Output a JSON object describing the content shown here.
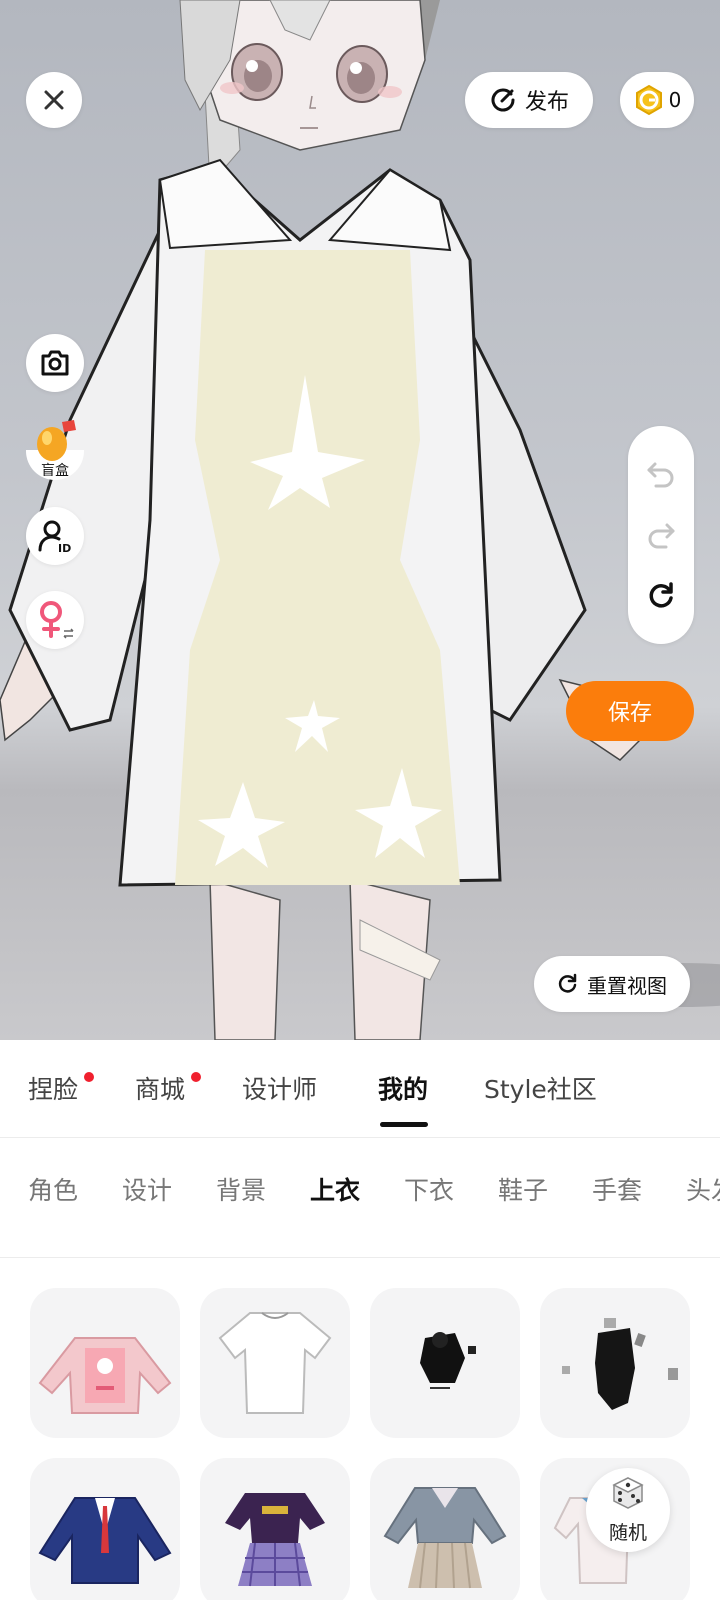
{
  "top_bar": {
    "close_icon": "close-icon",
    "publish_label": "发布",
    "publish_icon": "publish-icon",
    "coin_icon": "coin-icon",
    "coin_count": "0"
  },
  "side_tools": {
    "camera_icon": "camera-icon",
    "blind_box_label": "盲盒",
    "blind_box_icon": "egg-icon",
    "avatar_id_icon": "avatar-id-icon",
    "gender_icon": "female-gender-icon"
  },
  "history": {
    "undo_icon": "undo-icon",
    "redo_icon": "redo-icon",
    "refresh_icon": "refresh-icon"
  },
  "save_label": "保存",
  "reset_view_label": "重置视图",
  "main_tabs": [
    {
      "label": "捏脸",
      "badge": true
    },
    {
      "label": "商城",
      "badge": true
    },
    {
      "label": "设计师",
      "badge": false
    },
    {
      "label": "我的",
      "badge": false,
      "active": true
    },
    {
      "label": "Style社区",
      "badge": false
    }
  ],
  "sub_tabs": [
    {
      "label": "角色"
    },
    {
      "label": "设计"
    },
    {
      "label": "背景"
    },
    {
      "label": "上衣",
      "active": true
    },
    {
      "label": "下衣"
    },
    {
      "label": "鞋子"
    },
    {
      "label": "手套"
    },
    {
      "label": "头发"
    }
  ],
  "items": [
    {
      "name": "pink-bunny-sweater"
    },
    {
      "name": "white-tshirt"
    },
    {
      "name": "black-top"
    },
    {
      "name": "black-bodysuit"
    },
    {
      "name": "navy-blazer"
    },
    {
      "name": "purple-plaid-dress"
    },
    {
      "name": "gray-sailor-uniform"
    },
    {
      "name": "white-sailor-top"
    }
  ],
  "random_label": "随机",
  "colors": {
    "accent": "#fb7d0c",
    "badge": "#f0202e",
    "text": "#111111"
  }
}
